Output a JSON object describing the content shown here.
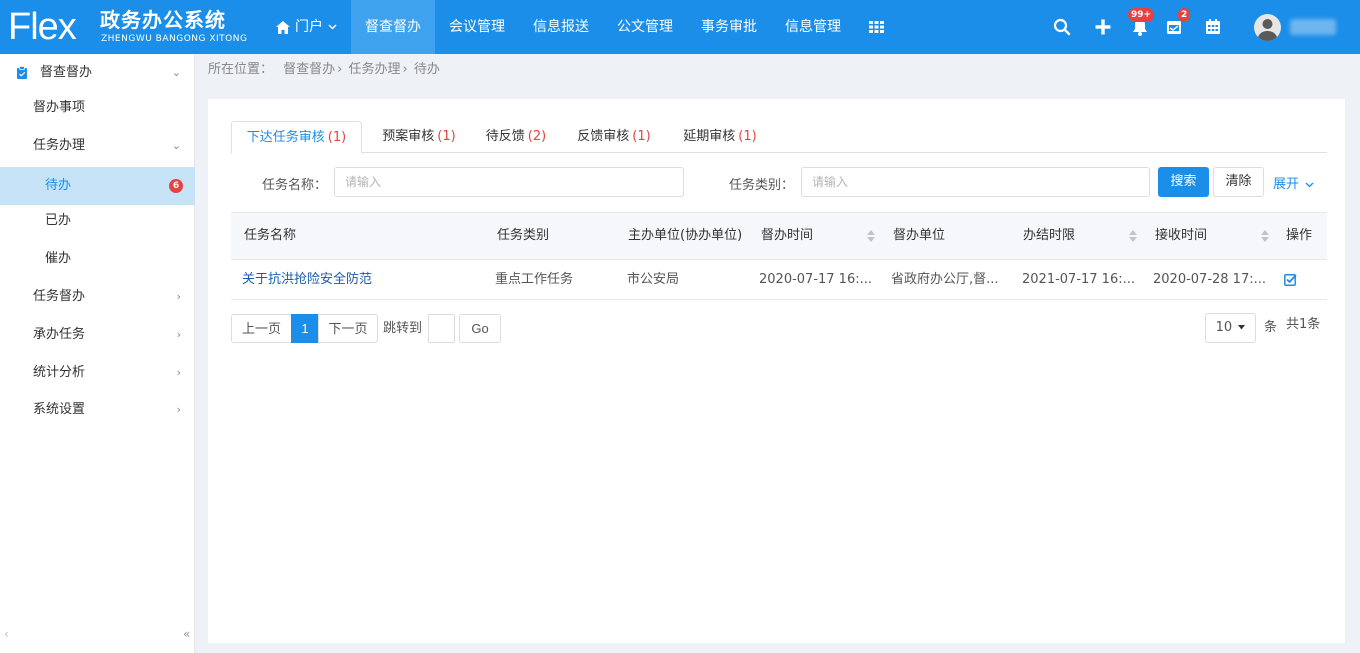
{
  "app": {
    "logo_flex": "Flex",
    "logo_cn": "政务办公系统",
    "logo_en": "ZHENGWU BANGONG XITONG"
  },
  "nav": {
    "items": [
      {
        "label": "门户"
      },
      {
        "label": "督查督办"
      },
      {
        "label": "会议管理"
      },
      {
        "label": "信息报送"
      },
      {
        "label": "公文管理"
      },
      {
        "label": "事务审批"
      },
      {
        "label": "信息管理"
      }
    ],
    "notification_badge": "99+",
    "message_badge": "2"
  },
  "sidebar": {
    "group_title": "督查督办",
    "items": [
      {
        "label": "督办事项"
      },
      {
        "label": "任务办理"
      },
      {
        "label": "待办",
        "badge": "6"
      },
      {
        "label": "已办"
      },
      {
        "label": "催办"
      },
      {
        "label": "任务督办"
      },
      {
        "label": "承办任务"
      },
      {
        "label": "统计分析"
      },
      {
        "label": "系统设置"
      }
    ]
  },
  "breadcrumb": {
    "prefix": "所在位置：",
    "path": [
      "督查督办",
      "任务办理",
      "待办"
    ]
  },
  "tabs": [
    {
      "label": "下达任务审核",
      "count": "(1)"
    },
    {
      "label": "预案审核",
      "count": "(1)"
    },
    {
      "label": "待反馈",
      "count": "(2)"
    },
    {
      "label": "反馈审核",
      "count": "(1)"
    },
    {
      "label": "延期审核",
      "count": "(1)"
    }
  ],
  "filters": {
    "task_name_label": "任务名称：",
    "task_name_placeholder": "请输入",
    "task_type_label": "任务类别：",
    "task_type_placeholder": "请输入",
    "search_label": "搜索",
    "clear_label": "清除",
    "expand_label": "展开"
  },
  "table": {
    "columns": [
      "任务名称",
      "任务类别",
      "主办单位(协办单位)",
      "督办时间",
      "督办单位",
      "办结时限",
      "接收时间",
      "操作"
    ],
    "rows": [
      {
        "name": "关于抗洪抢险安全防范",
        "type": "重点工作任务",
        "org": "市公安局",
        "supervise_time": "2020-07-17 16:...",
        "supervise_org": "省政府办公厅,督...",
        "deadline": "2021-07-17 16:...",
        "receive_time": "2020-07-28 17:..."
      }
    ]
  },
  "pager": {
    "prev": "上一页",
    "current": "1",
    "next": "下一页",
    "jump_label": "跳转到",
    "go": "Go",
    "page_size": "10",
    "unit": "条",
    "total": "共1条"
  },
  "colors": {
    "primary": "#1a8ee8",
    "nav_active": "#3ea2ef",
    "badge": "#e64340",
    "sidebar_active": "#c7e3f8"
  }
}
